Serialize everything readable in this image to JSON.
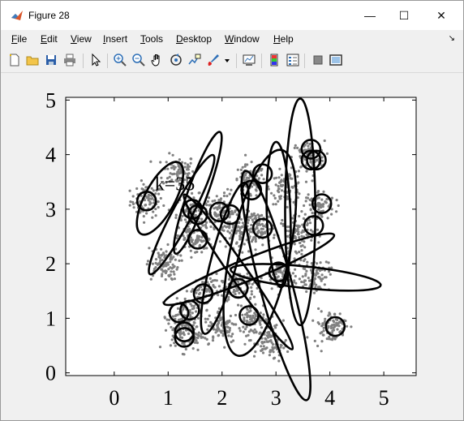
{
  "window": {
    "title": "Figure 28",
    "controls": {
      "minimize": "—",
      "maximize": "☐",
      "close": "✕"
    }
  },
  "menu": {
    "items": [
      {
        "label": "File",
        "underline": "F",
        "rest": "ile"
      },
      {
        "label": "Edit",
        "underline": "E",
        "rest": "dit"
      },
      {
        "label": "View",
        "underline": "V",
        "rest": "iew"
      },
      {
        "label": "Insert",
        "underline": "I",
        "rest": "nsert"
      },
      {
        "label": "Tools",
        "underline": "T",
        "rest": "ools"
      },
      {
        "label": "Desktop",
        "underline": "D",
        "rest": "esktop"
      },
      {
        "label": "Window",
        "underline": "W",
        "rest": "indow"
      },
      {
        "label": "Help",
        "underline": "H",
        "rest": "elp"
      }
    ],
    "dock_glyph": "↘"
  },
  "toolbar": {
    "buttons": [
      "new-figure-icon",
      "open-file-icon",
      "save-icon",
      "print-icon",
      "select-arrow-icon",
      "zoom-in-icon",
      "zoom-out-icon",
      "pan-hand-icon",
      "rotate-3d-icon",
      "data-cursor-icon",
      "brush-icon",
      "brush-dropdown-icon",
      "link-plot-icon",
      "colorbar-icon",
      "legend-icon",
      "hide-plot-tools-icon",
      "show-plot-tools-icon"
    ]
  },
  "chart_data": {
    "type": "scatter",
    "title": "",
    "xlabel": "",
    "ylabel": "",
    "xlim": [
      -0.9,
      5.6
    ],
    "ylim": [
      -0.05,
      5.05
    ],
    "xticks": [
      0,
      1,
      2,
      3,
      4,
      5
    ],
    "yticks": [
      0,
      1,
      2,
      3,
      4,
      5
    ],
    "grid": false,
    "annotation": "k=35",
    "annotation_pos": [
      0.75,
      3.35
    ],
    "point_color": "#808080",
    "cluster_centers": [
      [
        0.6,
        3.15
      ],
      [
        1.2,
        3.7
      ],
      [
        1.45,
        2.95
      ],
      [
        2.0,
        2.95
      ],
      [
        2.5,
        3.5
      ],
      [
        3.2,
        3.4
      ],
      [
        3.6,
        3.95
      ],
      [
        3.8,
        3.05
      ],
      [
        0.9,
        2.0
      ],
      [
        1.5,
        2.45
      ],
      [
        2.3,
        2.6
      ],
      [
        2.7,
        2.65
      ],
      [
        3.4,
        2.55
      ],
      [
        2.3,
        1.6
      ],
      [
        3.1,
        1.75
      ],
      [
        3.7,
        1.8
      ],
      [
        1.7,
        1.5
      ],
      [
        1.3,
        1.05
      ],
      [
        1.35,
        0.7
      ],
      [
        2.0,
        0.85
      ],
      [
        2.6,
        1.0
      ],
      [
        4.0,
        0.85
      ],
      [
        2.9,
        0.55
      ]
    ],
    "markers": [
      [
        0.6,
        3.15
      ],
      [
        1.45,
        3.0
      ],
      [
        1.55,
        2.9
      ],
      [
        1.95,
        2.95
      ],
      [
        2.15,
        2.9
      ],
      [
        1.55,
        2.45
      ],
      [
        2.55,
        3.35
      ],
      [
        2.75,
        3.65
      ],
      [
        2.75,
        2.65
      ],
      [
        3.65,
        3.9
      ],
      [
        3.75,
        3.9
      ],
      [
        3.65,
        4.1
      ],
      [
        3.85,
        3.1
      ],
      [
        3.7,
        2.7
      ],
      [
        3.05,
        1.85
      ],
      [
        2.3,
        1.55
      ],
      [
        1.65,
        1.45
      ],
      [
        1.2,
        1.1
      ],
      [
        1.4,
        1.15
      ],
      [
        1.3,
        0.75
      ],
      [
        1.3,
        0.65
      ],
      [
        2.5,
        1.05
      ],
      [
        4.1,
        0.85
      ]
    ],
    "ellipses": [
      {
        "center": [
          0.85,
          3.2
        ],
        "rx": 0.75,
        "ry": 0.28,
        "angle": -62
      },
      {
        "center": [
          1.25,
          2.9
        ],
        "rx": 1.25,
        "ry": 0.18,
        "angle": -62
      },
      {
        "center": [
          1.55,
          3.3
        ],
        "rx": 1.2,
        "ry": 0.18,
        "angle": -70
      },
      {
        "center": [
          2.05,
          2.1
        ],
        "rx": 1.45,
        "ry": 0.24,
        "angle": -75
      },
      {
        "center": [
          2.3,
          1.85
        ],
        "rx": 1.75,
        "ry": 0.16,
        "angle": 55
      },
      {
        "center": [
          2.7,
          2.2
        ],
        "rx": 1.95,
        "ry": 0.55,
        "angle": -78
      },
      {
        "center": [
          2.5,
          1.9
        ],
        "rx": 1.7,
        "ry": 0.2,
        "angle": -22
      },
      {
        "center": [
          3.0,
          1.6
        ],
        "rx": 2.2,
        "ry": 0.3,
        "angle": 75
      },
      {
        "center": [
          3.05,
          2.9
        ],
        "rx": 1.35,
        "ry": 0.22,
        "angle": 88
      },
      {
        "center": [
          3.45,
          2.95
        ],
        "rx": 2.1,
        "ry": 0.28,
        "angle": 90
      },
      {
        "center": [
          3.55,
          1.75
        ],
        "rx": 1.4,
        "ry": 0.2,
        "angle": 6
      }
    ]
  }
}
